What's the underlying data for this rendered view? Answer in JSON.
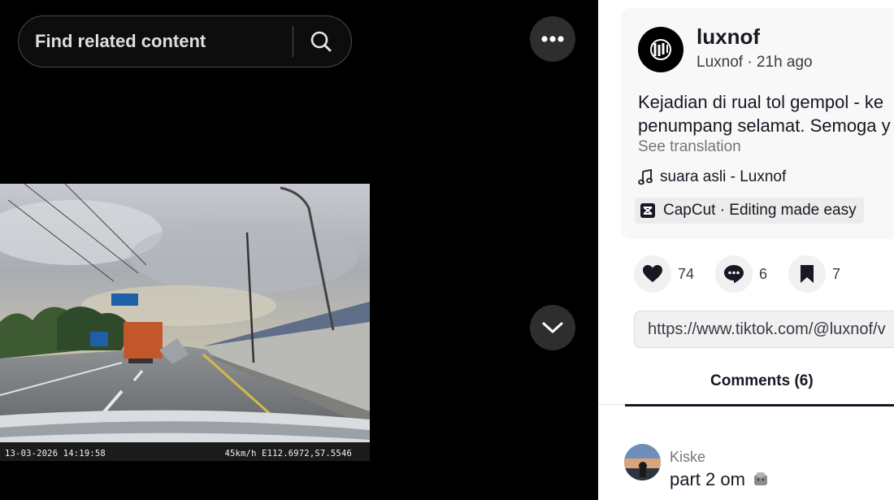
{
  "search": {
    "placeholder": "Find related content"
  },
  "video": {
    "osd_datetime": "13-03-2026 14:19:58",
    "osd_gps": "45km/h E112.6972,S7.5546"
  },
  "post": {
    "username": "luxnof",
    "meta": "Luxnof · 21h ago",
    "description_line1": "Kejadian di rual tol gempol - ke",
    "description_line2": "penumpang selamat. Semoga y",
    "see_translation": "See translation",
    "music": "suara asli - Luxnof",
    "capcut": "CapCut · Editing made easy"
  },
  "actions": {
    "likes": "74",
    "comments": "6",
    "saves": "7"
  },
  "link": {
    "url": "https://www.tiktok.com/@luxnof/v"
  },
  "tabs": {
    "comments_label": "Comments (6)"
  },
  "comment": {
    "name": "Kiske",
    "text": "part 2 om"
  },
  "icons": {
    "search": "search-icon",
    "more": "more-horizontal-icon",
    "down": "chevron-down-icon",
    "music": "music-note-icon",
    "capcut": "capcut-logo-icon",
    "like": "heart-icon",
    "comment": "comment-icon",
    "save": "bookmark-icon"
  },
  "colors": {
    "background": "#000000",
    "panel": "#ffffff",
    "text": "#161823",
    "muted": "#73757a"
  }
}
